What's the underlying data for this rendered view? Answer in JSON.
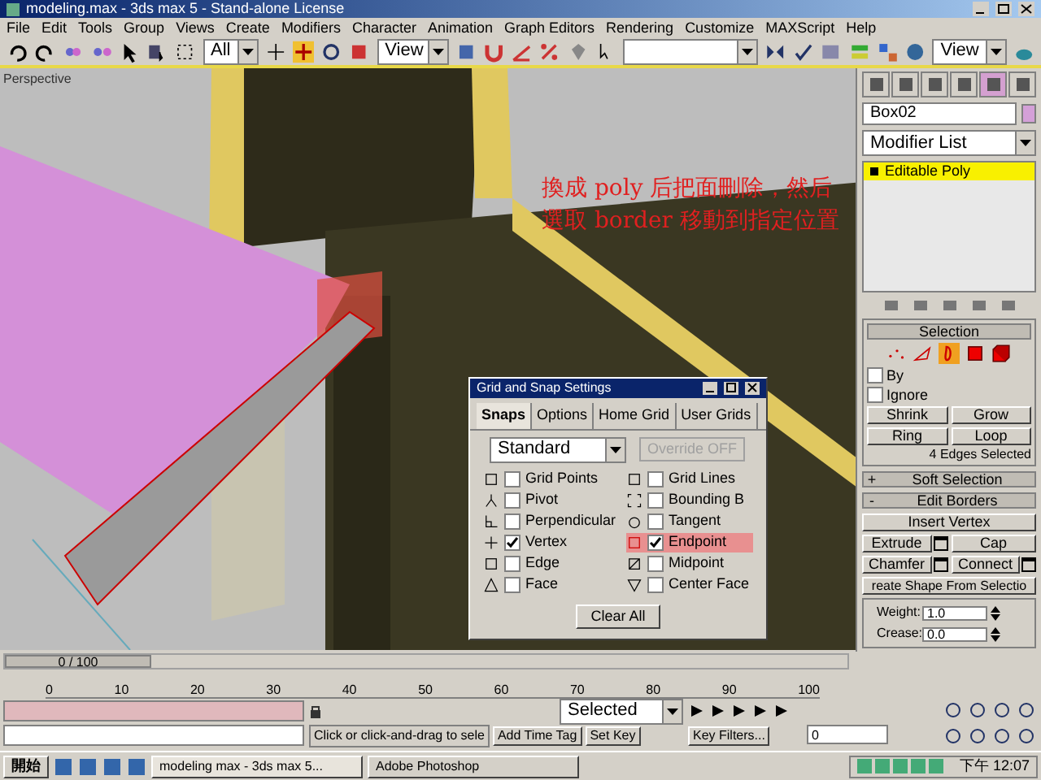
{
  "window": {
    "title": "modeling.max - 3ds max 5 - Stand-alone License"
  },
  "menu": [
    "File",
    "Edit",
    "Tools",
    "Group",
    "Views",
    "Create",
    "Modifiers",
    "Character",
    "Animation",
    "Graph Editors",
    "Rendering",
    "Customize",
    "MAXScript",
    "Help"
  ],
  "toolbar": {
    "selection_filter": "All",
    "reference_coord": "View",
    "view_dropdown": "View"
  },
  "viewport": {
    "label": "Perspective",
    "annotation": [
      "換成 poly 后把面刪除，然后",
      "選取 border 移動到指定位置"
    ]
  },
  "command_panel": {
    "object_name": "Box02",
    "modifier_list": "Modifier List",
    "stack": [
      {
        "label": "Editable Poly",
        "selected": true
      }
    ],
    "selection": {
      "title": "Selection",
      "levels": [
        {
          "kind": "vertex",
          "selected": false
        },
        {
          "kind": "edge",
          "selected": false
        },
        {
          "kind": "border",
          "selected": true
        },
        {
          "kind": "polygon",
          "selected": false
        },
        {
          "kind": "element",
          "selected": false
        }
      ],
      "options": [
        {
          "label": "By",
          "checked": false
        },
        {
          "label": "Ignore",
          "checked": false
        }
      ],
      "buttons": [
        "Shrink",
        "Grow",
        "Ring",
        "Loop"
      ],
      "status": "4 Edges Selected"
    },
    "rollouts": [
      {
        "sign": "+",
        "title": "Soft Selection"
      },
      {
        "sign": "-",
        "title": "Edit Borders"
      }
    ],
    "edit_borders": {
      "wide_button": "Insert Vertex",
      "pairs": [
        {
          "label": "Extrude",
          "settings": true
        },
        {
          "label": "Cap",
          "settings": false
        },
        {
          "label": "Chamfer",
          "settings": true
        },
        {
          "label": "Connect",
          "settings": true
        }
      ],
      "create_shape": "reate Shape From Selectio",
      "weight_label": "Weight:",
      "weight": "1.0",
      "crease_label": "Crease:",
      "crease": "0.0"
    }
  },
  "dialog": {
    "title": "Grid and Snap Settings",
    "tabs": [
      {
        "label": "Snaps",
        "selected": true
      },
      {
        "label": "Options",
        "selected": false
      },
      {
        "label": "Home Grid",
        "selected": false
      },
      {
        "label": "User Grids",
        "selected": false
      }
    ],
    "preset": "Standard",
    "override": "Override OFF",
    "snaps": [
      {
        "label": "Grid Points",
        "checked": false,
        "highlighted": false
      },
      {
        "label": "Grid Lines",
        "checked": false,
        "highlighted": false
      },
      {
        "label": "Pivot",
        "checked": false,
        "highlighted": false
      },
      {
        "label": "Bounding B",
        "checked": false,
        "highlighted": false
      },
      {
        "label": "Perpendicular",
        "checked": false,
        "highlighted": false
      },
      {
        "label": "Tangent",
        "checked": false,
        "highlighted": false
      },
      {
        "label": "Vertex",
        "checked": true,
        "highlighted": false
      },
      {
        "label": "Endpoint",
        "checked": true,
        "highlighted": true
      },
      {
        "label": "Edge",
        "checked": false,
        "highlighted": false
      },
      {
        "label": "Midpoint",
        "checked": false,
        "highlighted": false
      },
      {
        "label": "Face",
        "checked": false,
        "highlighted": false
      },
      {
        "label": "Center Face",
        "checked": false,
        "highlighted": false
      }
    ],
    "button": "Clear All"
  },
  "timeline": {
    "slider": "0 / 100",
    "ticks": [
      "0",
      "10",
      "20",
      "30",
      "40",
      "50",
      "60",
      "70",
      "80",
      "90",
      "100"
    ]
  },
  "status_bar": {
    "prompt": "Click or click-and-drag to sele",
    "add_time_tag": "Add Time Tag",
    "set_key": "Set Key",
    "key_mode": "Selected",
    "key_filters": "Key Filters...",
    "frame": "0"
  },
  "taskbar": {
    "start": "開始",
    "tasks": [
      "modeling max - 3ds max 5...",
      "Adobe Photoshop"
    ],
    "clock": "下午 12:07"
  }
}
